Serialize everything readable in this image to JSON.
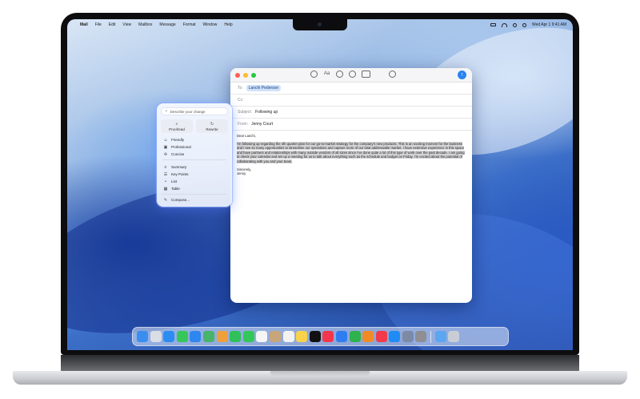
{
  "menubar": {
    "app": "Mail",
    "items": [
      "File",
      "Edit",
      "View",
      "Mailbox",
      "Message",
      "Format",
      "Window",
      "Help"
    ],
    "clock": "Wed Apr 1 9:41 AM"
  },
  "mail": {
    "to_label": "To:",
    "to_value": "Lanchi Pederson",
    "cc_label": "Cc:",
    "subject_label": "Subject:",
    "subject_value": "Following up",
    "from_label": "From:",
    "from_value": "Jenny Court",
    "greeting": "Dear Lanchi,",
    "paragraph": "I'm following up regarding the 4th quarter plan for our go-to-market strategy for the company's new products. This is an exciting moment for the business and I see so many opportunities to streamline our operations and capture more of our total addressable market. I have extensive experience in this space and have partners and relationships with many outside vendors of all sizes since I've done quite a lot of this type of work over the past decade. I am going to check your calendar and set up a meeting for us to talk about everything such as the schedule and budget on Friday. I'm excited about the potential of collaborating with you and your team.",
    "signoff": "Sincerely,",
    "signature": "Jenny",
    "send_icon": "arrow-up-icon"
  },
  "writing_tools": {
    "describe_placeholder": "Describe your change",
    "proofread": "Proofread",
    "rewrite": "Rewrite",
    "tones": [
      "Friendly",
      "Professional",
      "Concise"
    ],
    "transforms": [
      "Summary",
      "Key Points",
      "List",
      "Table"
    ],
    "compose": "Compose..."
  },
  "dock": {
    "apps": [
      {
        "name": "finder",
        "color": "#3a8ef0"
      },
      {
        "name": "launchpad",
        "color": "#d9dde6"
      },
      {
        "name": "safari",
        "color": "#2d8cf2"
      },
      {
        "name": "messages",
        "color": "#35c759"
      },
      {
        "name": "mail",
        "color": "#2f86ef"
      },
      {
        "name": "maps",
        "color": "#48b36a"
      },
      {
        "name": "photos",
        "color": "#f0a03a"
      },
      {
        "name": "facetime",
        "color": "#31c05a"
      },
      {
        "name": "phone",
        "color": "#33c75a"
      },
      {
        "name": "calendar",
        "color": "#f5f5f5"
      },
      {
        "name": "contacts",
        "color": "#c8a57a"
      },
      {
        "name": "reminders",
        "color": "#f2f2f2"
      },
      {
        "name": "notes",
        "color": "#f7d24a"
      },
      {
        "name": "tv",
        "color": "#111111"
      },
      {
        "name": "music",
        "color": "#f4364c"
      },
      {
        "name": "keynote",
        "color": "#2f7cf0"
      },
      {
        "name": "numbers",
        "color": "#2fb14d"
      },
      {
        "name": "pages",
        "color": "#f08a24"
      },
      {
        "name": "news",
        "color": "#f23a4b"
      },
      {
        "name": "app-store",
        "color": "#1f8cf5"
      },
      {
        "name": "iphone-mirroring",
        "color": "#7c8aa6"
      },
      {
        "name": "system-settings",
        "color": "#8e8e93"
      },
      {
        "name": "downloads",
        "color": "#5aa6f0"
      },
      {
        "name": "trash",
        "color": "#c9ced6"
      }
    ]
  }
}
